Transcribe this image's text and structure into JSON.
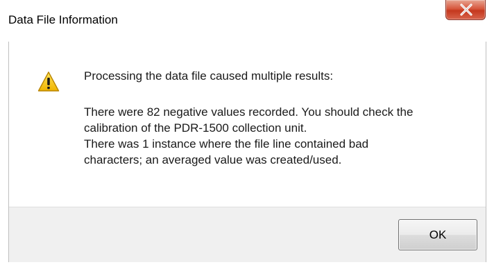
{
  "window": {
    "title": "Data File Information",
    "close_glyph": "X"
  },
  "message": {
    "icon": "warning-icon",
    "heading": "Processing the data file caused multiple results:",
    "lines": [
      "There were 82 negative values recorded. You should check the",
      "calibration of the PDR-1500 collection unit.",
      "There was 1 instance where the file line contained bad",
      "characters; an averaged value was created/used."
    ]
  },
  "buttons": {
    "ok_label": "OK"
  },
  "colors": {
    "close_button": "#c4381e",
    "warning_yellow": "#f5c400",
    "footer": "#f0f0f0"
  }
}
